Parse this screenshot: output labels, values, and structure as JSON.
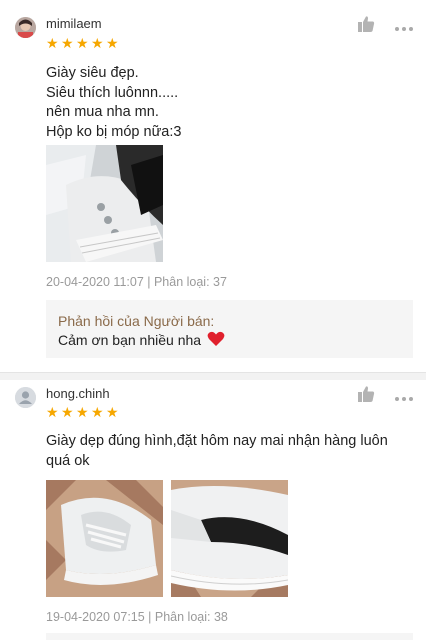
{
  "reviews": [
    {
      "username": "mimilaem",
      "rating": 5,
      "text": "Giày siêu đẹp.\nSiêu thích luônnn.....\nnên mua nha mn.\nHộp ko bị móp nữa:3",
      "meta": "20-04-2020 11:07 | Phân loại: 37",
      "reply_title": "Phản hồi của Người bán:",
      "reply_text": "Cảm ơn bạn nhiều nha"
    },
    {
      "username": "hong.chinh",
      "rating": 5,
      "text": "Giày dẹp  đúng hình,đặt hôm nay mai nhận hàng  luôn quá ok",
      "meta": "19-04-2020 07:15 | Phân loại: 38"
    }
  ],
  "icons": {
    "star": "star-icon",
    "like": "thumbs-up-icon",
    "more": "more-dots-icon",
    "heart": "heart-icon"
  },
  "colors": {
    "star": "#f6a700",
    "reply_title": "#8a6a4a",
    "meta": "#9a9a9a",
    "heart": "#e0202d"
  }
}
